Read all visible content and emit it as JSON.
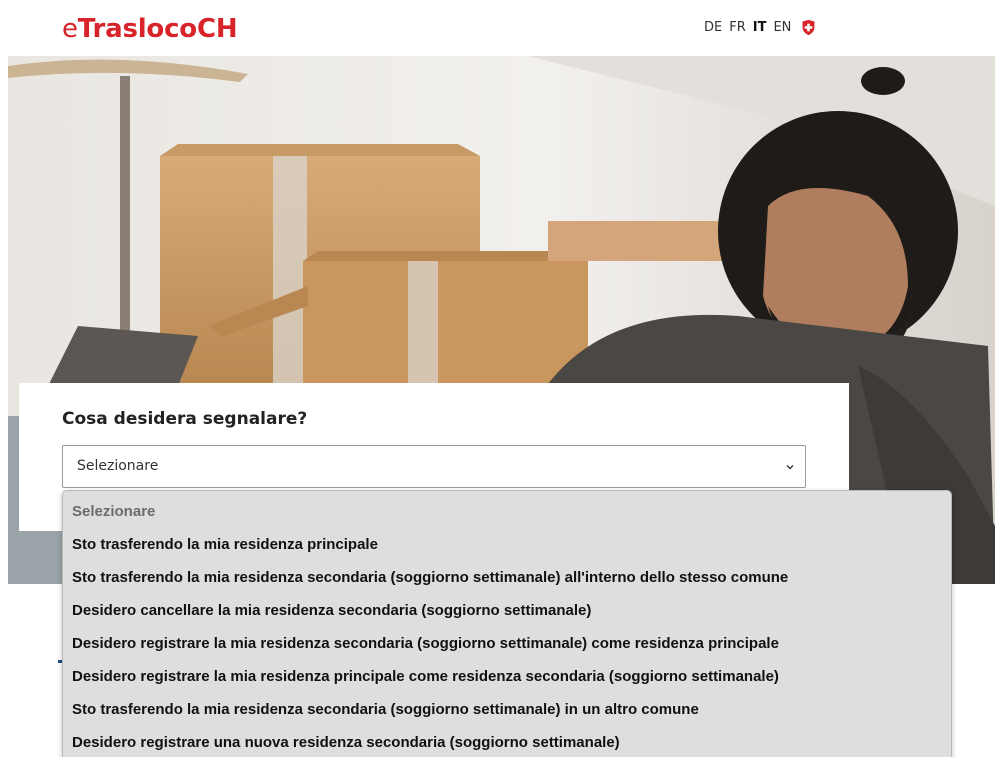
{
  "header": {
    "logo_prefix": "e",
    "logo_main": "TraslocoCH",
    "languages": [
      "DE",
      "FR",
      "IT",
      "EN"
    ],
    "active_language": "IT"
  },
  "form": {
    "question": "Cosa desidera segnalare?",
    "selected_value": "Selezionare"
  },
  "dropdown": {
    "options": [
      "Selezionare",
      "Sto trasferendo la mia residenza principale",
      "Sto trasferendo la mia residenza secondaria (soggiorno settimanale) all'interno dello stesso comune",
      "Desidero cancellare la mia residenza secondaria (soggiorno settimanale)",
      "Desidero registrare la mia residenza secondaria (soggiorno settimanale) come residenza principale",
      "Desidero registrare la mia residenza principale come residenza secondaria (soggiorno settimanale)",
      "Sto trasferendo la mia residenza secondaria (soggiorno settimanale) in un altro comune",
      "Desidero registrare una nuova residenza secondaria (soggiorno settimanale)"
    ]
  },
  "colors": {
    "brand": "#d8232a",
    "accent": "#1f4e8c"
  }
}
